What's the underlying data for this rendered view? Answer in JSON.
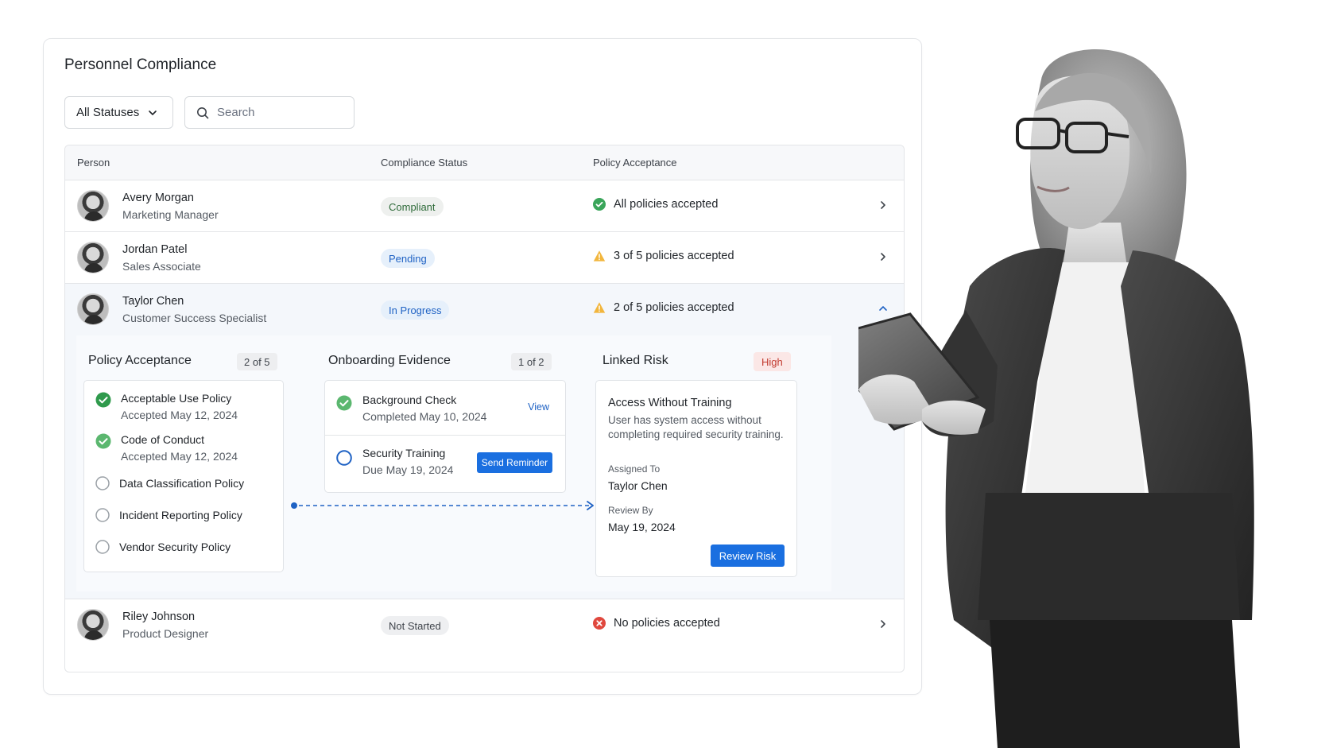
{
  "page_title": "Personnel Compliance",
  "filter": {
    "label": "All Statuses"
  },
  "search": {
    "placeholder": "Search"
  },
  "table": {
    "headers": {
      "person": "Person",
      "status": "Compliance Status",
      "policy": "Policy Acceptance"
    },
    "rows": [
      {
        "name": "Avery Morgan",
        "role": "Marketing Manager",
        "status": "Compliant",
        "policy": "All policies accepted"
      },
      {
        "name": "Jordan Patel",
        "role": "Sales Associate",
        "status": "Pending",
        "policy": "3 of 5 policies accepted"
      },
      {
        "name": "Taylor Chen",
        "role": "Customer Success Specialist",
        "status": "In Progress",
        "policy": "2 of 5 policies accepted"
      },
      {
        "name": "Riley Johnson",
        "role": "Product Designer",
        "status": "Not Started",
        "policy": "No policies accepted"
      }
    ]
  },
  "expanded": {
    "policy_acceptance": {
      "title": "Policy Acceptance",
      "count": "2 of 5",
      "items": [
        {
          "name": "Acceptable Use Policy",
          "detail": "Accepted May 12, 2024"
        },
        {
          "name": "Code of Conduct",
          "detail": "Accepted May 12, 2024"
        },
        {
          "name": "Data Classification Policy"
        },
        {
          "name": "Incident Reporting Policy"
        },
        {
          "name": "Vendor Security Policy"
        }
      ]
    },
    "onboarding": {
      "title": "Onboarding Evidence",
      "count": "1 of 2",
      "items": [
        {
          "name": "Background Check",
          "detail": "Completed May 10, 2024",
          "action": "View"
        },
        {
          "name": "Security Training",
          "detail": "Due May 19, 2024",
          "action": "Send Reminder"
        }
      ]
    },
    "linked_risk": {
      "title": "Linked Risk",
      "severity": "High",
      "risk_title": "Access Without Training",
      "description_line1": "User has system access without",
      "description_line2": "completing required security training.",
      "assigned_label": "Assigned To",
      "assigned_value": "Taylor Chen",
      "review_label": "Review By",
      "review_value": "May 19, 2024",
      "action": "Review Risk"
    }
  },
  "colors": {
    "accent": "#1a6fe0",
    "success": "#3aa55a",
    "warning": "#f2b63d",
    "danger": "#e0483e"
  }
}
